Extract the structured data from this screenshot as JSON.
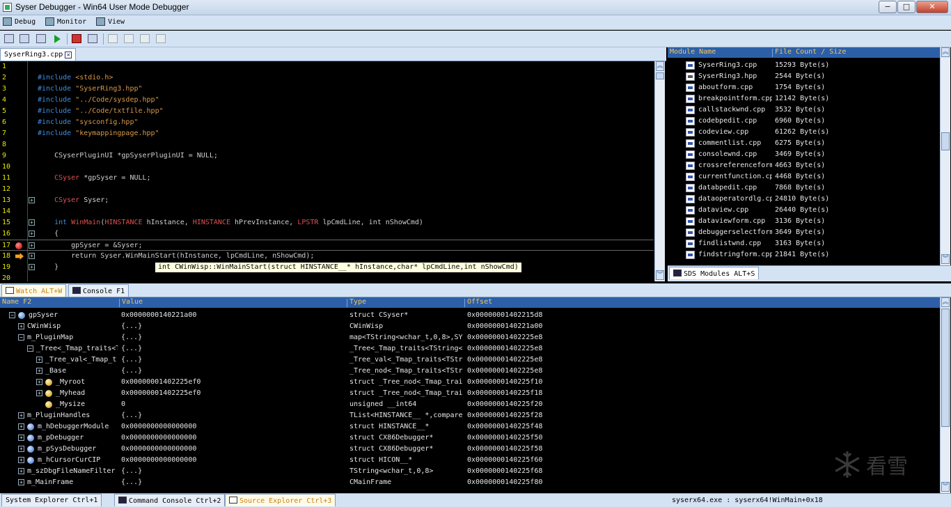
{
  "window": {
    "title": "Syser Debugger - Win64 User Mode Debugger",
    "min": "−",
    "max": "□",
    "close": "✕"
  },
  "menu": [
    {
      "label": "Debug"
    },
    {
      "label": "Monitor"
    },
    {
      "label": "View"
    }
  ],
  "editor": {
    "tab_label": "SyserRing3.cpp",
    "lines": [
      {
        "n": "1",
        "text": "",
        "fold": false,
        "marker": ""
      },
      {
        "n": "2",
        "pre": "#include ",
        "str": "<stdio.h>",
        "fold": false,
        "marker": ""
      },
      {
        "n": "3",
        "pre": "#include ",
        "str": "\"SyserRing3.hpp\"",
        "fold": false,
        "marker": ""
      },
      {
        "n": "4",
        "pre": "#include ",
        "str": "\"../Code/sysdep.hpp\"",
        "fold": false,
        "marker": ""
      },
      {
        "n": "5",
        "pre": "#include ",
        "str": "\"../Code/txtfile.hpp\"",
        "fold": false,
        "marker": ""
      },
      {
        "n": "6",
        "pre": "#include ",
        "str": "\"sysconfig.hpp\"",
        "fold": false,
        "marker": ""
      },
      {
        "n": "7",
        "pre": "#include ",
        "str": "\"keymappingpage.hpp\"",
        "fold": false,
        "marker": ""
      },
      {
        "n": "8",
        "text": "",
        "fold": false,
        "marker": ""
      },
      {
        "n": "9",
        "text": "    CSyserPluginUI *gpSyserPluginUI = NULL;",
        "fold": false,
        "marker": ""
      },
      {
        "n": "10",
        "text": "",
        "fold": false,
        "marker": ""
      },
      {
        "n": "11",
        "type": "    CSyser",
        "text": " *gpSyser = NULL;",
        "fold": false,
        "marker": ""
      },
      {
        "n": "12",
        "text": "",
        "fold": false,
        "marker": ""
      },
      {
        "n": "13",
        "type": "    CSyser",
        "text": " Syser;",
        "fold": true,
        "marker": ""
      },
      {
        "n": "14",
        "text": "",
        "fold": false,
        "marker": ""
      },
      {
        "n": "15",
        "winmain": true,
        "fold": true,
        "marker": ""
      },
      {
        "n": "16",
        "text": "    {",
        "fold": true,
        "marker": ""
      },
      {
        "n": "17",
        "text": "        gpSyser = &Syser;",
        "fold": true,
        "marker": "bp"
      },
      {
        "n": "18",
        "text": "        return Syser.WinMainStart(hInstance, lpCmdLine, nShowCmd);",
        "fold": true,
        "marker": "arrow"
      },
      {
        "n": "19",
        "text": "    }",
        "fold": true,
        "marker": ""
      },
      {
        "n": "20",
        "text": "",
        "fold": false,
        "marker": ""
      }
    ],
    "winmain": {
      "ret": "    int ",
      "fn": "WinMain",
      "p1": "HINSTANCE",
      "a1": " hInstance, ",
      "p2": "HINSTANCE",
      "a2": " hPrevInstance, ",
      "p3": "LPSTR",
      "a3": " lpCmdLine, int nShowCmd)"
    },
    "tooltip": "int CWinWisp::WinMainStart(struct HINSTANCE__* hInstance,char* lpCmdLine,int nShowCmd)"
  },
  "modules": {
    "headers": {
      "name": "Module Name",
      "size": "File Count / Size"
    },
    "tab_label": "SDS Modules ALT+S",
    "rows": [
      {
        "icon": "cpp",
        "name": "SyserRing3.cpp",
        "size": "15293 Byte(s)"
      },
      {
        "icon": "h",
        "name": "SyserRing3.hpp",
        "size": "2544 Byte(s)"
      },
      {
        "icon": "cpp",
        "name": "aboutform.cpp",
        "size": "1754 Byte(s)"
      },
      {
        "icon": "cpp",
        "name": "breakpointform.cpp",
        "size": "12142 Byte(s)"
      },
      {
        "icon": "cpp",
        "name": "callstackwnd.cpp",
        "size": "3532 Byte(s)"
      },
      {
        "icon": "cpp",
        "name": "codebpedit.cpp",
        "size": "6960 Byte(s)"
      },
      {
        "icon": "cpp",
        "name": "codeview.cpp",
        "size": "61262 Byte(s)"
      },
      {
        "icon": "cpp",
        "name": "commentlist.cpp",
        "size": "6275 Byte(s)"
      },
      {
        "icon": "cpp",
        "name": "consolewnd.cpp",
        "size": "3469 Byte(s)"
      },
      {
        "icon": "cpp",
        "name": "crossreferenceform",
        "size": "4663 Byte(s)"
      },
      {
        "icon": "cpp",
        "name": "currentfunction.cpp",
        "size": "4468 Byte(s)"
      },
      {
        "icon": "cpp",
        "name": "databpedit.cpp",
        "size": "7868 Byte(s)"
      },
      {
        "icon": "cpp",
        "name": "dataoperatordlg.cpp",
        "size": "24810 Byte(s)"
      },
      {
        "icon": "cpp",
        "name": "dataview.cpp",
        "size": "26440 Byte(s)"
      },
      {
        "icon": "cpp",
        "name": "dataviewform.cpp",
        "size": "3136 Byte(s)"
      },
      {
        "icon": "cpp",
        "name": "debuggerselectform",
        "size": "3649 Byte(s)"
      },
      {
        "icon": "cpp",
        "name": "findlistwnd.cpp",
        "size": "3163 Byte(s)"
      },
      {
        "icon": "cpp",
        "name": "findstringform.cpp",
        "size": "21841 Byte(s)"
      }
    ]
  },
  "watch": {
    "tabs": [
      {
        "label": "Watch ALT+W"
      },
      {
        "label": "Console F1"
      }
    ],
    "headers": {
      "name": "Name F2",
      "value": "Value",
      "type": "Type",
      "offset": "Offset"
    },
    "rows": [
      {
        "indent": 0,
        "exp": "-",
        "icon": "blue",
        "name": "gpSyser",
        "value": "0x0000000140221a00",
        "type": "struct CSyser*",
        "offset": "0x00000001402215d8"
      },
      {
        "indent": 1,
        "exp": "+",
        "icon": "",
        "name": "CWinWisp",
        "value": "{...}",
        "type": "CWinWisp",
        "offset": "0x0000000140221a00"
      },
      {
        "indent": 1,
        "exp": "-",
        "icon": "",
        "name": "m_PluginMap",
        "value": "{...}",
        "type": "map<TString<wchar_t,0,8>,SY:",
        "offset": "0x00000001402225e8"
      },
      {
        "indent": 2,
        "exp": "-",
        "icon": "",
        "name": "_Tree<_Tmap_traits<TSt",
        "value": "{...}",
        "type": "_Tree<_Tmap_traits<TString<",
        "offset": "0x00000001402225e8"
      },
      {
        "indent": 3,
        "exp": "+",
        "icon": "",
        "name": "_Tree_val<_Tmap_trai",
        "value": "{...}",
        "type": "_Tree_val<_Tmap_traits<TStr",
        "offset": "0x00000001402225e8"
      },
      {
        "indent": 3,
        "exp": "+",
        "icon": "",
        "name": "_Base",
        "value": "{...}",
        "type": "_Tree_nod<_Tmap_traits<TStr",
        "offset": "0x00000001402225e8"
      },
      {
        "indent": 3,
        "exp": "+",
        "icon": "gold",
        "name": "_Myroot",
        "value": "0x00000001402225ef0",
        "type": "struct _Tree_nod<_Tmap_trai",
        "offset": "0x0000000140225f10"
      },
      {
        "indent": 3,
        "exp": "+",
        "icon": "gold",
        "name": "_Myhead",
        "value": "0x00000001402225ef0",
        "type": "struct _Tree_nod<_Tmap_trai",
        "offset": "0x0000000140225f18"
      },
      {
        "indent": 3,
        "exp": "",
        "icon": "gold",
        "name": "_Mysize",
        "value": "0",
        "type": "unsigned __int64",
        "offset": "0x0000000140225f20"
      },
      {
        "indent": 1,
        "exp": "+",
        "icon": "",
        "name": "m_PluginHandles",
        "value": "{...}",
        "type": "TList<HINSTANCE__ *,compare_",
        "offset": "0x0000000140225f28"
      },
      {
        "indent": 1,
        "exp": "+",
        "icon": "blue",
        "name": "m_hDebuggerModule",
        "value": "0x0000000000000000",
        "type": "struct HINSTANCE__*",
        "offset": "0x0000000140225f48"
      },
      {
        "indent": 1,
        "exp": "+",
        "icon": "blue",
        "name": "m_pDebugger",
        "value": "0x0000000000000000",
        "type": "struct CX86Debugger*",
        "offset": "0x0000000140225f50"
      },
      {
        "indent": 1,
        "exp": "+",
        "icon": "blue",
        "name": "m_pSysDebugger",
        "value": "0x0000000000000000",
        "type": "struct CX86Debugger*",
        "offset": "0x0000000140225f58"
      },
      {
        "indent": 1,
        "exp": "+",
        "icon": "blue",
        "name": "m_hCursorCurCIP",
        "value": "0x0000000000000000",
        "type": "struct HICON__*",
        "offset": "0x0000000140225f60"
      },
      {
        "indent": 1,
        "exp": "+",
        "icon": "",
        "name": "m_szDbgFileNameFilter",
        "value": "{...}",
        "type": "TString<wchar_t,0,8>",
        "offset": "0x0000000140225f68"
      },
      {
        "indent": 1,
        "exp": "+",
        "icon": "",
        "name": "m_MainFrame",
        "value": "{...}",
        "type": "CMainFrame",
        "offset": "0x0000000140225f80"
      }
    ]
  },
  "bottom_tabs": [
    {
      "label": "System Explorer Ctrl+1"
    },
    {
      "label": "Command Console Ctrl+2"
    },
    {
      "label": "Source Explorer Ctrl+3"
    }
  ],
  "status": "syserx64.exe : syserx64!WinMain+0x18",
  "watermark": "看雪",
  "colors": {
    "chrome": "#d4e3f4",
    "header": "#2c5fa8",
    "header_text": "#f2c55e",
    "line_number": "#e6e600",
    "preprocessor": "#3f8fe0",
    "string": "#d89a4a",
    "type": "#e05050"
  }
}
